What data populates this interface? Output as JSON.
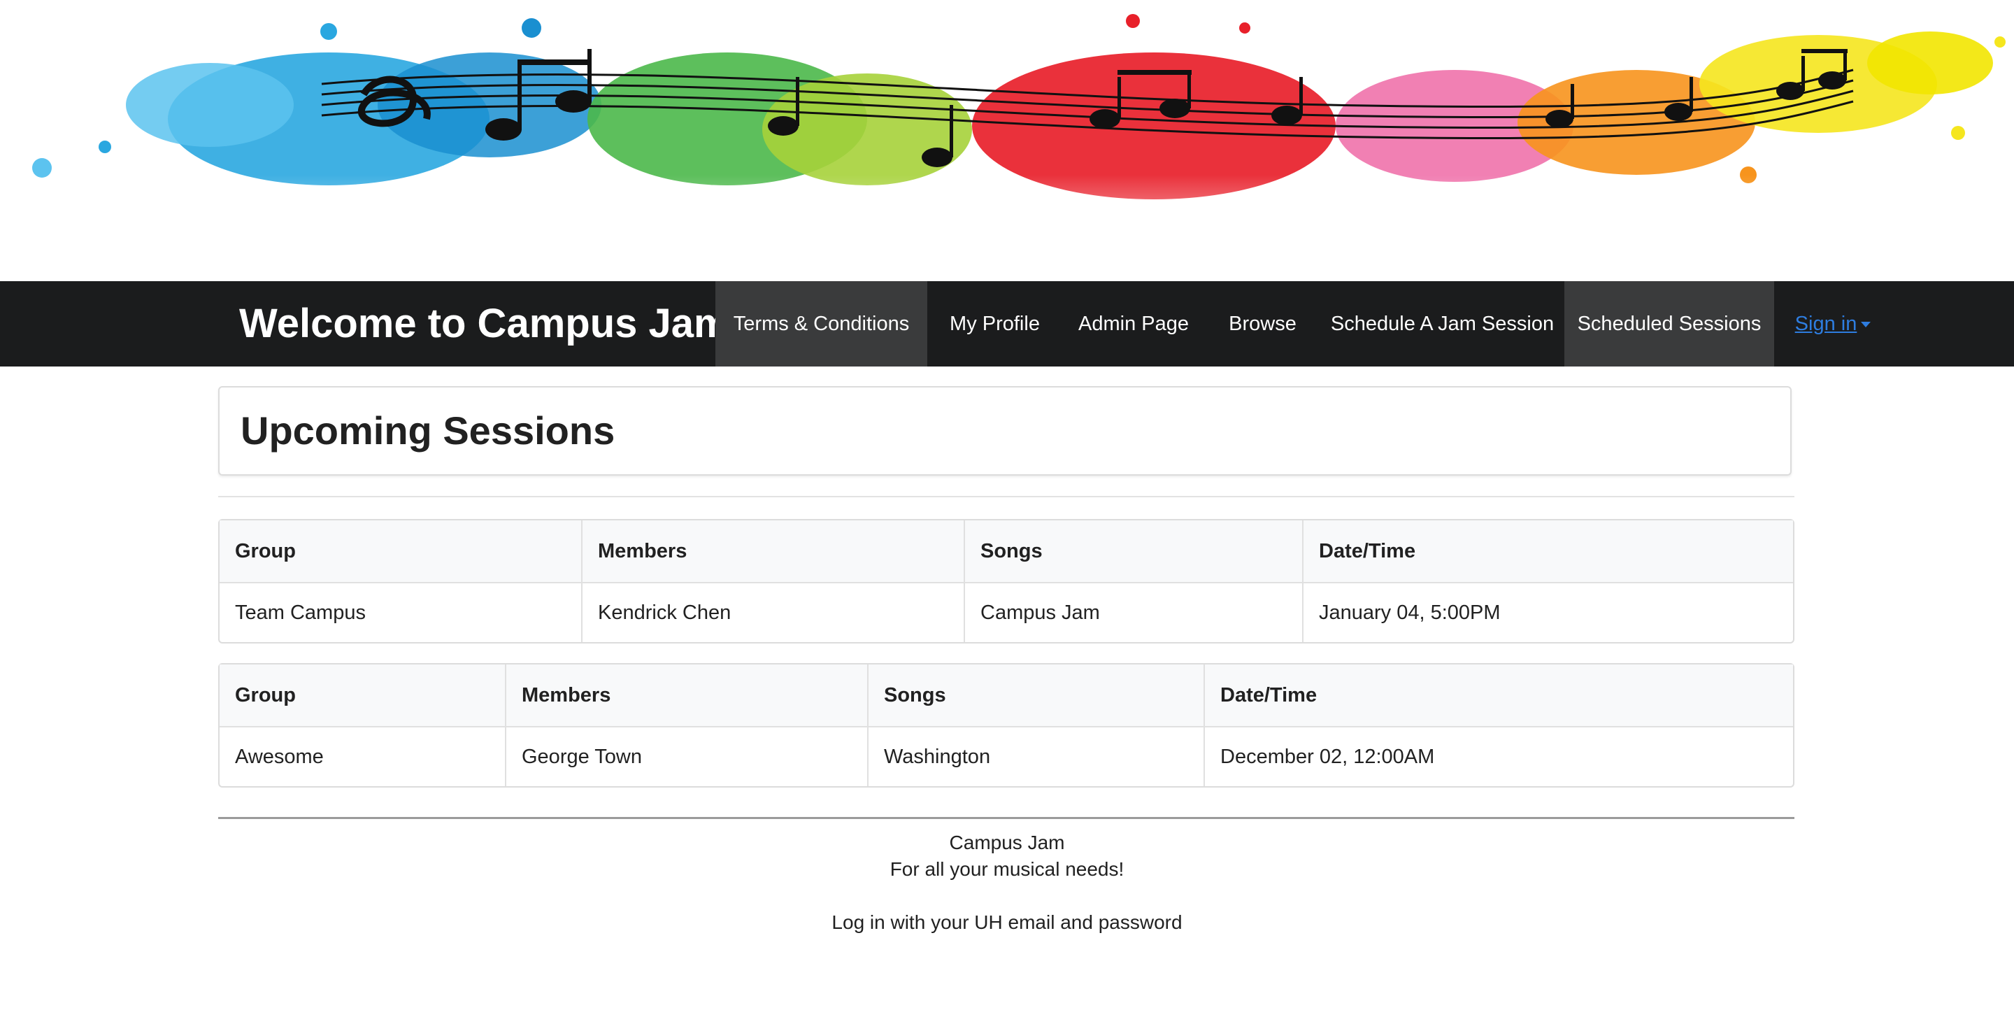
{
  "navbar": {
    "brand": "Welcome to Campus Jam!",
    "items": [
      {
        "label": "Terms & Conditions",
        "active": true
      },
      {
        "label": "My Profile",
        "active": false
      },
      {
        "label": "Admin Page",
        "active": false
      },
      {
        "label": "Browse",
        "active": false
      },
      {
        "label": "Schedule A Jam Session",
        "active": false
      },
      {
        "label": "Scheduled Sessions",
        "active": true
      }
    ],
    "signin": "Sign in"
  },
  "main": {
    "title": "Upcoming Sessions",
    "tables": [
      {
        "headers": [
          "Group",
          "Members",
          "Songs",
          "Date/Time"
        ],
        "rows": [
          [
            "Team Campus",
            "Kendrick Chen",
            "Campus Jam",
            "January 04, 5:00PM"
          ]
        ]
      },
      {
        "headers": [
          "Group",
          "Members",
          "Songs",
          "Date/Time"
        ],
        "rows": [
          [
            "Awesome",
            "George Town",
            "Washington",
            "December 02, 12:00AM"
          ]
        ]
      }
    ]
  },
  "footer": {
    "line1": "Campus Jam",
    "line2": "For all your musical needs!",
    "line3": "Log in with your UH email and password"
  },
  "colors": {
    "navbar_bg": "#1b1c1d",
    "nav_active_bg": "#3a3b3c",
    "signin_link": "#2e7de0"
  }
}
